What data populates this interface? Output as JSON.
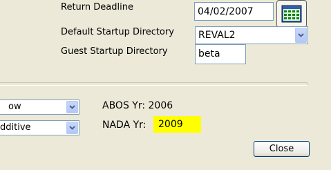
{
  "settings": {
    "return_deadline_label": "Return Deadline",
    "return_deadline_value": "04/02/2007",
    "default_startup_label": "Default Startup Directory",
    "default_startup_value": "REVAL2",
    "guest_startup_label": "Guest Startup Directory",
    "guest_startup_value": "beta"
  },
  "lower": {
    "combo1_value": "ow",
    "combo2_value": "​dditive",
    "abos_label": "ABOS Yr: 2006",
    "nada_label": "NADA Yr:",
    "nada_value": "2009",
    "close_label": "Close"
  },
  "colors": {
    "background": "#ece9d8",
    "highlight": "#ffff00",
    "combo_button": "#b4c8f6"
  },
  "icons": {
    "calendar": "calendar-icon",
    "dropdown": "chevron-down-icon"
  }
}
